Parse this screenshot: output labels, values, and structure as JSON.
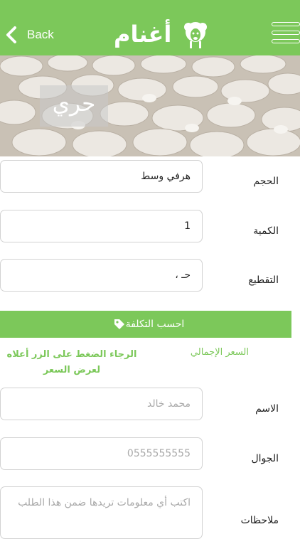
{
  "header": {
    "back_label": "Back",
    "title": "أغنام",
    "bg_color": "#7cc85a",
    "icons": [
      "chevron-left-icon",
      "sheep-icon",
      "hamburger-menu-icon"
    ]
  },
  "hero": {
    "label": "حري",
    "image": "herd-of-sheep-photo"
  },
  "form": {
    "size": {
      "label": "الحجم",
      "value": "هرفي وسط"
    },
    "quantity": {
      "label": "الكمية",
      "value": "1"
    },
    "cutting": {
      "label": "التقطيع",
      "value": "حـ ،"
    },
    "calc_button": {
      "label": "احسب التكلفة",
      "icon": "tag-icon"
    },
    "total_price": {
      "label": "السعر الإجمالي",
      "message": "الرجاء الضغط على الزر أعلاه لعرض السعر"
    },
    "name": {
      "label": "الاسم",
      "placeholder": "محمد خالد"
    },
    "mobile": {
      "label": "الجوال",
      "placeholder": "0555555555"
    },
    "notes": {
      "label": "ملاحظات",
      "placeholder": "اكتب أي معلومات تريدها ضمن هذا الطلب"
    }
  }
}
